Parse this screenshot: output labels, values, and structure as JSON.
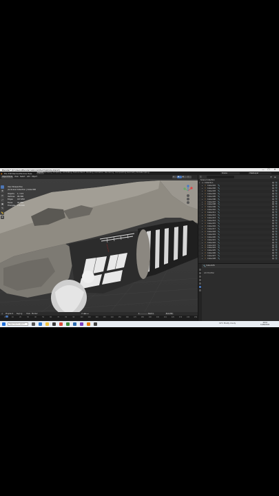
{
  "window": {
    "title": "Blender* [D:\\Users\\Blender\\Vehicle\\Mech\\Vehicle.blend]",
    "controls": [
      "—",
      "☐",
      "✕"
    ]
  },
  "menubar": {
    "items": [
      "File",
      "Edit",
      "Render",
      "Window",
      "Help"
    ],
    "workspaces": [
      "Layout",
      "Modeling",
      "Sculpting",
      "UV Editing",
      "Texture Paint",
      "Shading",
      "Animation",
      "Rendering",
      "Compositing",
      "Geometry Nodes",
      "Scripting"
    ],
    "active_workspace": "Layout",
    "scene": "Scene",
    "view_layer": "ViewLayer"
  },
  "viewport": {
    "header": [
      "Object Mode",
      "View",
      "Select",
      "Add",
      "Object"
    ],
    "stats": {
      "title_line1": "User Perspective",
      "title_line2": "(0) Scene Collection | Cube.026",
      "rows": [
        {
          "k": "Objects",
          "v": "1 / 115"
        },
        {
          "k": "Vertices",
          "v": "95,306"
        },
        {
          "k": "Edges",
          "v": "187,950"
        },
        {
          "k": "Faces",
          "v": "92,858"
        },
        {
          "k": "Triangles",
          "v": "178,590"
        }
      ]
    },
    "tools": [
      "⬚",
      "✥",
      "⟳",
      "⤢",
      "▣",
      "✎",
      "📏",
      "⊕"
    ]
  },
  "timeline": {
    "menus": [
      "Playback",
      "Keying",
      "View",
      "Marker"
    ],
    "frames": [
      "0",
      "10",
      "20",
      "30",
      "40",
      "50",
      "60",
      "70",
      "80",
      "90",
      "100",
      "110",
      "120",
      "130",
      "140",
      "150",
      "160",
      "170",
      "180",
      "190",
      "200",
      "210",
      "220",
      "230",
      "240",
      "250"
    ],
    "current": "1",
    "start_label": "Start",
    "start": "1",
    "end_label": "End",
    "end": "250"
  },
  "outliner": {
    "title": "Scene Collection",
    "rows": [
      {
        "label": "Collection",
        "depth": 1,
        "type": "collection"
      },
      {
        "label": "Cube.001",
        "depth": 2
      },
      {
        "label": "Cube.002",
        "depth": 2
      },
      {
        "label": "Cube.003",
        "depth": 2
      },
      {
        "label": "Cube.004",
        "depth": 2
      },
      {
        "label": "Cube.005",
        "depth": 2
      },
      {
        "label": "Cube.006",
        "depth": 2
      },
      {
        "label": "Cube.007",
        "depth": 2
      },
      {
        "label": "Cube.008",
        "depth": 2
      },
      {
        "label": "Cube.009",
        "depth": 2
      },
      {
        "label": "Cube.010",
        "depth": 2
      },
      {
        "label": "Cube.011",
        "depth": 2
      },
      {
        "label": "Cube.012",
        "depth": 2
      },
      {
        "label": "Cube.013",
        "depth": 2
      },
      {
        "label": "Cube.014",
        "depth": 2
      },
      {
        "label": "Cube.015",
        "depth": 2
      },
      {
        "label": "Cube.016",
        "depth": 2
      },
      {
        "label": "Cube.017",
        "depth": 2
      },
      {
        "label": "Cube.018",
        "depth": 2
      },
      {
        "label": "Cube.019",
        "depth": 2
      },
      {
        "label": "Cube.020",
        "depth": 2
      },
      {
        "label": "Cube.021",
        "depth": 2
      },
      {
        "label": "Cube.022",
        "depth": 2
      },
      {
        "label": "Cube.023",
        "depth": 2
      },
      {
        "label": "Cube.024",
        "depth": 2
      },
      {
        "label": "Cube.025",
        "depth": 2
      },
      {
        "label": "Cube.026",
        "depth": 2
      },
      {
        "label": "Cube.027",
        "depth": 2
      },
      {
        "label": "Cube.028",
        "depth": 2
      }
    ]
  },
  "properties": {
    "header": "Cube.026",
    "subheader": "Add Modifier"
  },
  "taskbar": {
    "search_placeholder": "Type here to search",
    "weather": "19°C  Mostly cloudy",
    "time": "16:42",
    "date": "14/08/2022"
  },
  "colors": {
    "accent": "#4772b3",
    "object_icon": "#e59a3c",
    "modifier_icon": "#5ab5d6"
  }
}
